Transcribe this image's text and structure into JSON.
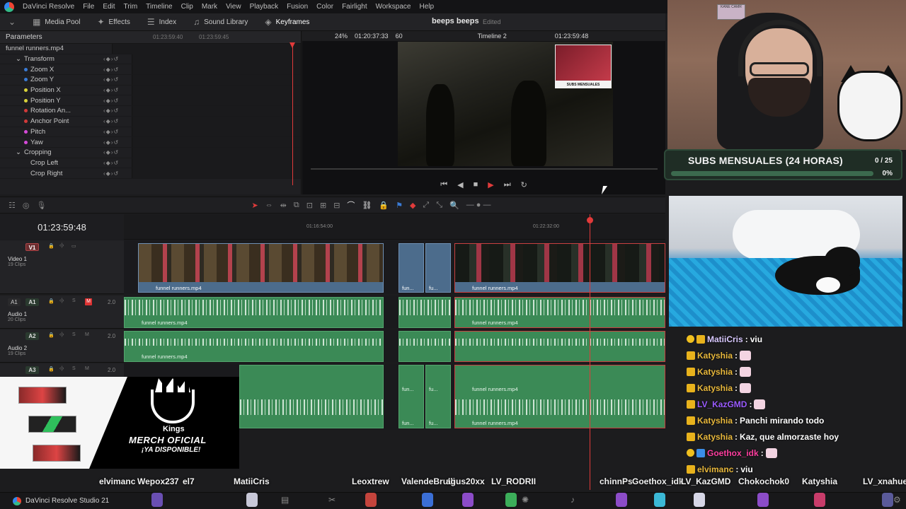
{
  "app": {
    "name": "DaVinci Resolve",
    "footer": "DaVinci Resolve Studio 21"
  },
  "menu": [
    "DaVinci Resolve",
    "File",
    "Edit",
    "Trim",
    "Timeline",
    "Clip",
    "Mark",
    "View",
    "Playback",
    "Fusion",
    "Color",
    "Fairlight",
    "Workspace",
    "Help"
  ],
  "toolbar": {
    "media_pool": "Media Pool",
    "effects": "Effects",
    "index": "Index",
    "sound_library": "Sound Library",
    "keyframes": "Keyframes",
    "project_title": "beeps beeps",
    "edited": "Edited"
  },
  "viewer": {
    "zoom": "24%",
    "source_timecode": "01:20:37:33",
    "fps": "60",
    "timeline_name": "Timeline 2",
    "record_timecode": "01:23:59:48"
  },
  "inspector": {
    "title": "Parameters",
    "ruler_tc1": "01:23:59:40",
    "ruler_tc2": "01:23:59:45",
    "clip_name": "funnel runners.mp4",
    "rows": [
      {
        "label": "Transform",
        "type": "group",
        "color": ""
      },
      {
        "label": "Zoom X",
        "type": "param",
        "color": "#3a7bd5"
      },
      {
        "label": "Zoom Y",
        "type": "param",
        "color": "#3a7bd5"
      },
      {
        "label": "Position X",
        "type": "param",
        "color": "#d9d23a"
      },
      {
        "label": "Position Y",
        "type": "param",
        "color": "#d9d23a"
      },
      {
        "label": "Rotation An...",
        "type": "param",
        "color": "#d23a3a"
      },
      {
        "label": "Anchor Point",
        "type": "param",
        "color": "#d23a3a"
      },
      {
        "label": "Pitch",
        "type": "param",
        "color": "#d54ad8"
      },
      {
        "label": "Yaw",
        "type": "param",
        "color": "#d54ad8"
      },
      {
        "label": "Cropping",
        "type": "group",
        "color": ""
      },
      {
        "label": "Crop Left",
        "type": "param",
        "color": ""
      },
      {
        "label": "Crop Right",
        "type": "param",
        "color": ""
      }
    ]
  },
  "timeline": {
    "timecode": "01:23:59:48",
    "ruler": [
      "01:16:54:00",
      "01:22:32:00"
    ],
    "tracks": [
      {
        "id": "V1",
        "name": "Video 1",
        "clips": "19 Clips",
        "level": ""
      },
      {
        "id": "A1",
        "name": "Audio 1",
        "clips": "20 Clips",
        "level": "2.0"
      },
      {
        "id": "A2",
        "name": "Audio 2",
        "clips": "19 Clips",
        "level": "2.0"
      },
      {
        "id": "A3",
        "name": "",
        "clips": "",
        "level": "2.0"
      }
    ],
    "clip_full": "funnel runners.mp4",
    "clip_short": "fun...",
    "clip_shorter": "fu..."
  },
  "overlay": {
    "subgoal_title": "SUBS MENSUALES (24 HORAS)",
    "subgoal_count": "0 / 25",
    "subgoal_pct": "0%",
    "subgoal_fraction": 0,
    "wall_sign": "KANE CAMR",
    "merch_brand": "Kings",
    "merch_line1": "MERCH OFICIAL",
    "merch_line2": "¡YA DISPONIBLE!",
    "viewer_frame_label": "SUBS MENSUALES"
  },
  "chat": [
    {
      "user": "MatiiCris",
      "msg": "viu",
      "color": "#d9c9ff",
      "badge": "coin+crown",
      "emote": false
    },
    {
      "user": "Katyshia",
      "msg": "",
      "color": "#e8b83c",
      "badge": "crown",
      "emote": true
    },
    {
      "user": "Katyshia",
      "msg": "",
      "color": "#e8b83c",
      "badge": "crown",
      "emote": true
    },
    {
      "user": "Katyshia",
      "msg": "",
      "color": "#e8b83c",
      "badge": "crown",
      "emote": true
    },
    {
      "user": "LV_KazGMD",
      "msg": "",
      "color": "#9a5bff",
      "badge": "crown",
      "emote": true
    },
    {
      "user": "Katyshia",
      "msg": "Panchi mirando todo",
      "color": "#e8b83c",
      "badge": "crown",
      "emote": false
    },
    {
      "user": "Katyshia",
      "msg": "Kaz, que almorzaste hoy",
      "color": "#e8b83c",
      "badge": "crown",
      "emote": false
    },
    {
      "user": "Goethox_idk",
      "msg": "",
      "color": "#ff3fa0",
      "badge": "shield+coin",
      "emote": true
    },
    {
      "user": "elvimanc",
      "msg": "viu",
      "color": "#e8b83c",
      "badge": "crown",
      "emote": false
    }
  ],
  "viewers": [
    "elvimanc",
    "Wepox23",
    "7",
    "el7",
    "MatiiCris",
    "Leoxtrew",
    "ValendeBrulli",
    "agus20xx",
    "LV_RODRII",
    "chinnPs",
    "Goethox_idk",
    "LV_KazGMD",
    "Chokochok0",
    "Katyshia",
    "LV_xnahuel"
  ]
}
